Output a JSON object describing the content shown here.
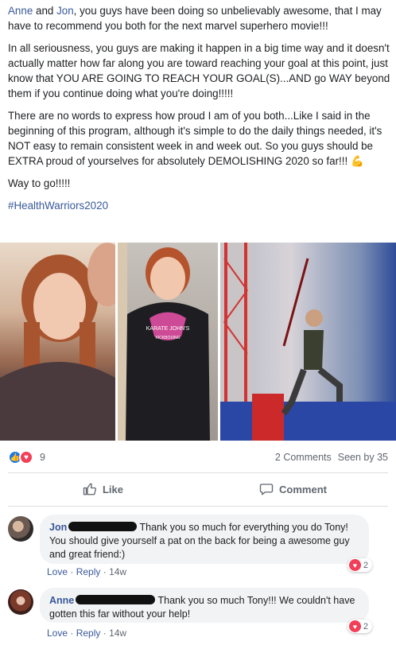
{
  "post": {
    "p1_name1": "Anne",
    "p1_and": " and ",
    "p1_name2": "Jon",
    "p1_rest": ", you guys have been doing so unbelievably awesome, that I may have to recommend you both for the next marvel superhero movie!!!",
    "p2": "In all seriousness, you guys are making it happen in a big time way and it doesn't actually matter how far along you are toward reaching your goal at this point, just know that YOU ARE GOING TO REACH YOUR GOAL(S)...AND go WAY beyond them if you continue doing what you're doing!!!!!",
    "p3": "There are no words to express how proud I am of you both...Like I said in the beginning of this program, although it's simple to do the daily things needed, it's NOT easy to remain consistent week in and week out. So you guys should be EXTRA proud of yourselves for absolutely DEMOLISHING 2020 so far!!!",
    "p3_emoji": "💪",
    "p4": "Way to go!!!!!",
    "hashtag": "#HealthWarriors2020"
  },
  "photos": {
    "shirt_text_1": "KARATE JOHN'S",
    "shirt_text_2": "KICKBOXING"
  },
  "reactions": {
    "count": "9",
    "comments": "2 Comments",
    "seen": "Seen by 35",
    "like_glyph": "👍",
    "love_glyph": "♥"
  },
  "actions": {
    "like_label": "Like",
    "comment_label": "Comment"
  },
  "comments": [
    {
      "name": "Jon",
      "text": "Thank you so much for everything you do Tony! You should give yourself a pat on the back for being a awesome guy and great friend:)",
      "love": "Love",
      "reply": "Reply",
      "time": "14w",
      "reaction_count": "2"
    },
    {
      "name": "Anne",
      "text": "Thank you so much Tony!!! We couldn't have gotten this far without your help!",
      "love": "Love",
      "reply": "Reply",
      "time": "14w",
      "reaction_count": "2"
    }
  ],
  "colors": {
    "link": "#385898",
    "like_blue": "#1877f2",
    "love_red": "#f33e58"
  }
}
